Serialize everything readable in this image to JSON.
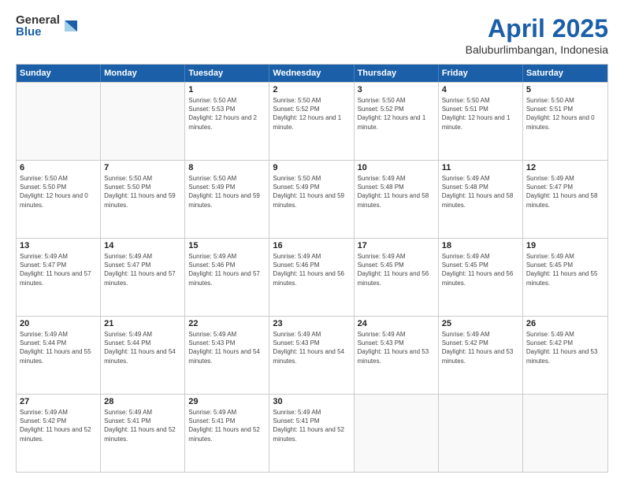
{
  "logo": {
    "general": "General",
    "blue": "Blue"
  },
  "title": {
    "month": "April 2025",
    "location": "Baluburlimbangan, Indonesia"
  },
  "header_days": [
    "Sunday",
    "Monday",
    "Tuesday",
    "Wednesday",
    "Thursday",
    "Friday",
    "Saturday"
  ],
  "weeks": [
    [
      {
        "day": "",
        "sunrise": "",
        "sunset": "",
        "daylight": "",
        "empty": true
      },
      {
        "day": "",
        "sunrise": "",
        "sunset": "",
        "daylight": "",
        "empty": true
      },
      {
        "day": "1",
        "sunrise": "Sunrise: 5:50 AM",
        "sunset": "Sunset: 5:53 PM",
        "daylight": "Daylight: 12 hours and 2 minutes.",
        "empty": false
      },
      {
        "day": "2",
        "sunrise": "Sunrise: 5:50 AM",
        "sunset": "Sunset: 5:52 PM",
        "daylight": "Daylight: 12 hours and 1 minute.",
        "empty": false
      },
      {
        "day": "3",
        "sunrise": "Sunrise: 5:50 AM",
        "sunset": "Sunset: 5:52 PM",
        "daylight": "Daylight: 12 hours and 1 minute.",
        "empty": false
      },
      {
        "day": "4",
        "sunrise": "Sunrise: 5:50 AM",
        "sunset": "Sunset: 5:51 PM",
        "daylight": "Daylight: 12 hours and 1 minute.",
        "empty": false
      },
      {
        "day": "5",
        "sunrise": "Sunrise: 5:50 AM",
        "sunset": "Sunset: 5:51 PM",
        "daylight": "Daylight: 12 hours and 0 minutes.",
        "empty": false
      }
    ],
    [
      {
        "day": "6",
        "sunrise": "Sunrise: 5:50 AM",
        "sunset": "Sunset: 5:50 PM",
        "daylight": "Daylight: 12 hours and 0 minutes.",
        "empty": false
      },
      {
        "day": "7",
        "sunrise": "Sunrise: 5:50 AM",
        "sunset": "Sunset: 5:50 PM",
        "daylight": "Daylight: 11 hours and 59 minutes.",
        "empty": false
      },
      {
        "day": "8",
        "sunrise": "Sunrise: 5:50 AM",
        "sunset": "Sunset: 5:49 PM",
        "daylight": "Daylight: 11 hours and 59 minutes.",
        "empty": false
      },
      {
        "day": "9",
        "sunrise": "Sunrise: 5:50 AM",
        "sunset": "Sunset: 5:49 PM",
        "daylight": "Daylight: 11 hours and 59 minutes.",
        "empty": false
      },
      {
        "day": "10",
        "sunrise": "Sunrise: 5:49 AM",
        "sunset": "Sunset: 5:48 PM",
        "daylight": "Daylight: 11 hours and 58 minutes.",
        "empty": false
      },
      {
        "day": "11",
        "sunrise": "Sunrise: 5:49 AM",
        "sunset": "Sunset: 5:48 PM",
        "daylight": "Daylight: 11 hours and 58 minutes.",
        "empty": false
      },
      {
        "day": "12",
        "sunrise": "Sunrise: 5:49 AM",
        "sunset": "Sunset: 5:47 PM",
        "daylight": "Daylight: 11 hours and 58 minutes.",
        "empty": false
      }
    ],
    [
      {
        "day": "13",
        "sunrise": "Sunrise: 5:49 AM",
        "sunset": "Sunset: 5:47 PM",
        "daylight": "Daylight: 11 hours and 57 minutes.",
        "empty": false
      },
      {
        "day": "14",
        "sunrise": "Sunrise: 5:49 AM",
        "sunset": "Sunset: 5:47 PM",
        "daylight": "Daylight: 11 hours and 57 minutes.",
        "empty": false
      },
      {
        "day": "15",
        "sunrise": "Sunrise: 5:49 AM",
        "sunset": "Sunset: 5:46 PM",
        "daylight": "Daylight: 11 hours and 57 minutes.",
        "empty": false
      },
      {
        "day": "16",
        "sunrise": "Sunrise: 5:49 AM",
        "sunset": "Sunset: 5:46 PM",
        "daylight": "Daylight: 11 hours and 56 minutes.",
        "empty": false
      },
      {
        "day": "17",
        "sunrise": "Sunrise: 5:49 AM",
        "sunset": "Sunset: 5:45 PM",
        "daylight": "Daylight: 11 hours and 56 minutes.",
        "empty": false
      },
      {
        "day": "18",
        "sunrise": "Sunrise: 5:49 AM",
        "sunset": "Sunset: 5:45 PM",
        "daylight": "Daylight: 11 hours and 56 minutes.",
        "empty": false
      },
      {
        "day": "19",
        "sunrise": "Sunrise: 5:49 AM",
        "sunset": "Sunset: 5:45 PM",
        "daylight": "Daylight: 11 hours and 55 minutes.",
        "empty": false
      }
    ],
    [
      {
        "day": "20",
        "sunrise": "Sunrise: 5:49 AM",
        "sunset": "Sunset: 5:44 PM",
        "daylight": "Daylight: 11 hours and 55 minutes.",
        "empty": false
      },
      {
        "day": "21",
        "sunrise": "Sunrise: 5:49 AM",
        "sunset": "Sunset: 5:44 PM",
        "daylight": "Daylight: 11 hours and 54 minutes.",
        "empty": false
      },
      {
        "day": "22",
        "sunrise": "Sunrise: 5:49 AM",
        "sunset": "Sunset: 5:43 PM",
        "daylight": "Daylight: 11 hours and 54 minutes.",
        "empty": false
      },
      {
        "day": "23",
        "sunrise": "Sunrise: 5:49 AM",
        "sunset": "Sunset: 5:43 PM",
        "daylight": "Daylight: 11 hours and 54 minutes.",
        "empty": false
      },
      {
        "day": "24",
        "sunrise": "Sunrise: 5:49 AM",
        "sunset": "Sunset: 5:43 PM",
        "daylight": "Daylight: 11 hours and 53 minutes.",
        "empty": false
      },
      {
        "day": "25",
        "sunrise": "Sunrise: 5:49 AM",
        "sunset": "Sunset: 5:42 PM",
        "daylight": "Daylight: 11 hours and 53 minutes.",
        "empty": false
      },
      {
        "day": "26",
        "sunrise": "Sunrise: 5:49 AM",
        "sunset": "Sunset: 5:42 PM",
        "daylight": "Daylight: 11 hours and 53 minutes.",
        "empty": false
      }
    ],
    [
      {
        "day": "27",
        "sunrise": "Sunrise: 5:49 AM",
        "sunset": "Sunset: 5:42 PM",
        "daylight": "Daylight: 11 hours and 52 minutes.",
        "empty": false
      },
      {
        "day": "28",
        "sunrise": "Sunrise: 5:49 AM",
        "sunset": "Sunset: 5:41 PM",
        "daylight": "Daylight: 11 hours and 52 minutes.",
        "empty": false
      },
      {
        "day": "29",
        "sunrise": "Sunrise: 5:49 AM",
        "sunset": "Sunset: 5:41 PM",
        "daylight": "Daylight: 11 hours and 52 minutes.",
        "empty": false
      },
      {
        "day": "30",
        "sunrise": "Sunrise: 5:49 AM",
        "sunset": "Sunset: 5:41 PM",
        "daylight": "Daylight: 11 hours and 52 minutes.",
        "empty": false
      },
      {
        "day": "",
        "sunrise": "",
        "sunset": "",
        "daylight": "",
        "empty": true
      },
      {
        "day": "",
        "sunrise": "",
        "sunset": "",
        "daylight": "",
        "empty": true
      },
      {
        "day": "",
        "sunrise": "",
        "sunset": "",
        "daylight": "",
        "empty": true
      }
    ]
  ]
}
